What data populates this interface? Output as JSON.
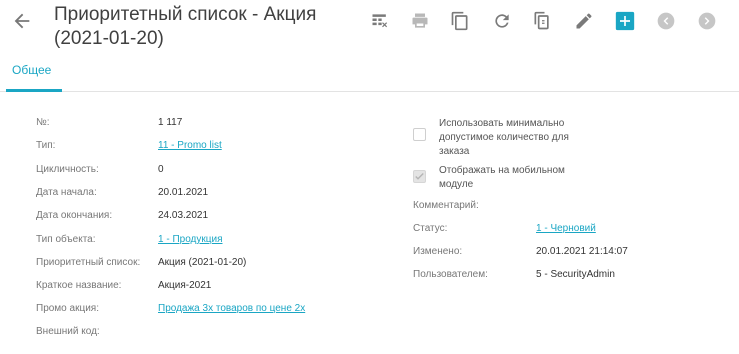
{
  "header": {
    "title": "Приоритетный список - Акция (2021-01-20)",
    "back_icon": "arrow-left-icon"
  },
  "toolbar": {
    "icons": [
      "table-delete-icon",
      "print-icon",
      "copy-icon",
      "refresh-icon",
      "duplicate-icon",
      "edit-icon",
      "add-icon",
      "previous-icon",
      "next-icon"
    ],
    "accent": "#1aa6c4"
  },
  "tabs": [
    {
      "label": "Общее",
      "active": true
    }
  ],
  "left_fields": [
    {
      "label": "№:",
      "value": "1 117",
      "link": false
    },
    {
      "label": "Тип:",
      "value": "11 - Promo list",
      "link": true
    },
    {
      "label": "Цикличность:",
      "value": "0",
      "link": false
    },
    {
      "label": "Дата начала:",
      "value": "20.01.2021",
      "link": false
    },
    {
      "label": "Дата окончания:",
      "value": "24.03.2021",
      "link": false
    },
    {
      "label": "Тип объекта:",
      "value": "1 - Продукция",
      "link": true
    },
    {
      "label": "Приоритетный список:",
      "value": "Акция (2021-01-20)",
      "link": false
    },
    {
      "label": "Краткое название:",
      "value": "Акция-2021",
      "link": false
    },
    {
      "label": "Промо акция:",
      "value": "Продажа 3х товаров по цене 2х",
      "link": true
    },
    {
      "label": "Внешний код:",
      "value": "",
      "link": false
    }
  ],
  "checkboxes": [
    {
      "label": "Использовать минимально допустимое количество для заказа",
      "checked": false
    },
    {
      "label": "Отображать на мобильном модуле",
      "checked": true
    }
  ],
  "right_fields": [
    {
      "label": "Комментарий:",
      "value": "",
      "link": false
    },
    {
      "label": "Статус:",
      "value": "1 - Черновий",
      "link": true
    },
    {
      "label": "Изменено:",
      "value": "20.01.2021 21:14:07",
      "link": false
    },
    {
      "label": "Пользователем:",
      "value": "5 - SecurityAdmin",
      "link": false
    }
  ]
}
